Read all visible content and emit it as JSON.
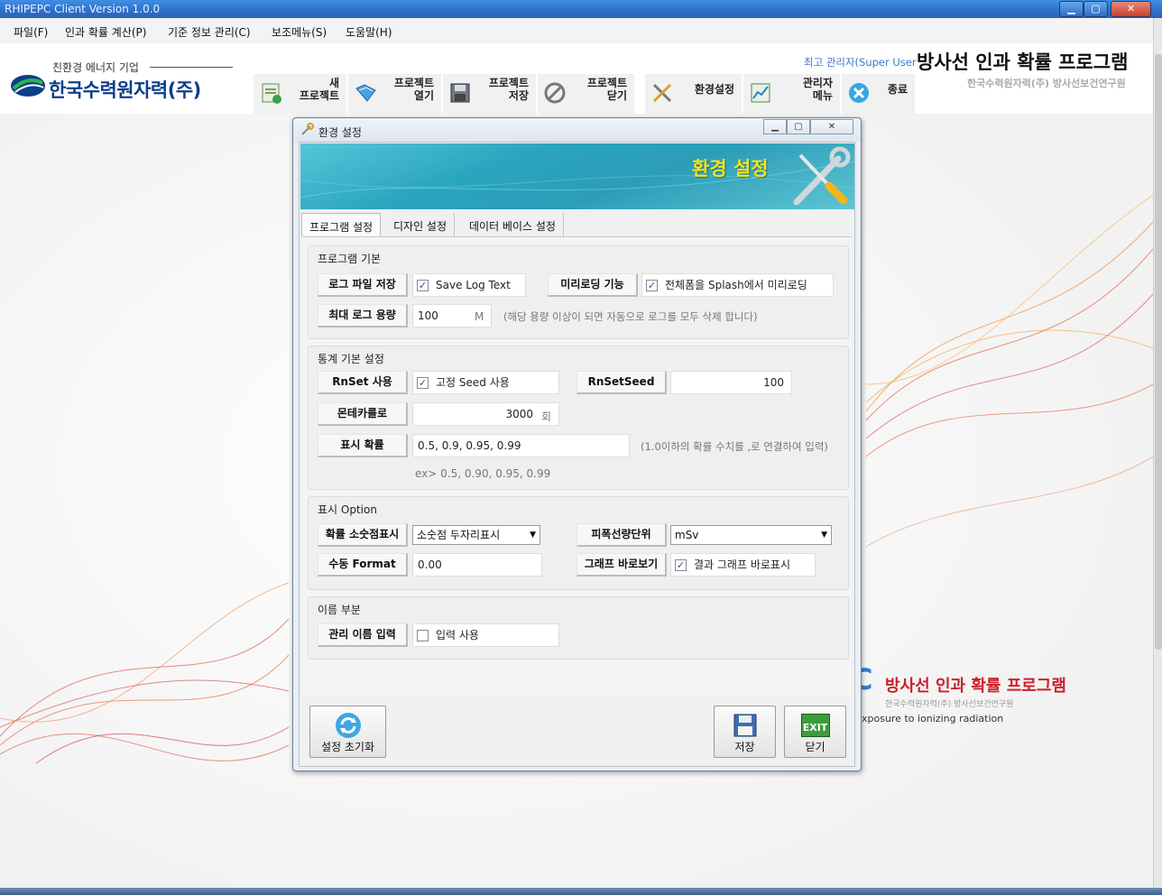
{
  "window": {
    "title": "RHIPEPC Client Version 1.0.0",
    "minimize": "▁",
    "maximize": "▢",
    "close": "✕"
  },
  "menu": [
    "파일(F)",
    "인과 확률 계산(P)",
    "기준 정보 관리(C)",
    "보조메뉴(S)",
    "도움말(H)"
  ],
  "brand": {
    "tagline": "친환경 에너지 기업",
    "name": "한국수력원자력(주)"
  },
  "toolbar": [
    {
      "label": "새\n프로젝트",
      "icon": "new-project-icon"
    },
    {
      "label": "프로젝트\n열기",
      "icon": "open-project-icon"
    },
    {
      "label": "프로젝트\n저장",
      "icon": "save-project-icon"
    },
    {
      "label": "프로젝트\n닫기",
      "icon": "close-project-icon"
    },
    {
      "label": "환경설정",
      "icon": "settings-tools-icon"
    },
    {
      "label": "관리자\n메뉴",
      "icon": "admin-chart-icon"
    },
    {
      "label": "종료",
      "icon": "exit-icon"
    }
  ],
  "header": {
    "user": "최고 관리자(Super User",
    "app_title": "방사선 인과 확률 프로그램",
    "app_sub": "한국수력원자력(주) 방사선보건연구원"
  },
  "background": {
    "title": "방사선 인과 확률 프로그램",
    "sub": "한국수력원자력(주) 방사선보건연구원",
    "tag": "xposure to ionizing radiation"
  },
  "dialog": {
    "title": "환경 설정",
    "banner_title": "환경 설정",
    "tabs": [
      "프로그램 설정",
      "디자인 설정",
      "데이터 베이스 설정"
    ],
    "groups": {
      "basic": {
        "title": "프로그램 기본",
        "log_save_label": "로그 파일 저장",
        "log_save_check": "Save Log Text",
        "log_save_checked": true,
        "preload_label": "미리로딩 기능",
        "preload_check": "전체폼을 Splash에서 미리로딩",
        "preload_checked": true,
        "max_log_label": "최대 로그 용량",
        "max_log_value": "100",
        "max_log_unit": "M",
        "max_log_hint": "(해당 용량 이상이 되면 자동으로 로그를 모두 삭제 합니다)"
      },
      "stats": {
        "title": "통계 기본 설정",
        "rnset_label": "RnSet 사용",
        "rnset_check": "고정 Seed 사용",
        "rnset_checked": true,
        "rnseed_label": "RnSetSeed",
        "rnseed_value": "100",
        "monte_label": "몬테카를로",
        "monte_value": "3000",
        "monte_unit": "회",
        "prob_label": "표시 확률",
        "prob_value": "0.5, 0.9, 0.95, 0.99",
        "prob_hint": "(1.0이하의 확률 수치를 ,로 연결하여 입력)",
        "prob_example": "ex> 0.5, 0.90, 0.95, 0.99"
      },
      "display": {
        "title": "표시 Option",
        "decimal_label": "확률 소숫점표시",
        "decimal_value": "소숫점 두자리표시",
        "dose_label": "피폭선량단위",
        "dose_value": "mSv",
        "format_label": "수동 Format",
        "format_value": "0.00",
        "graph_label": "그래프 바로보기",
        "graph_check": "결과 그래프 바로표시",
        "graph_checked": true
      },
      "name": {
        "title": "이름 부분",
        "manage_label": "관리 이름 입력",
        "manage_check": "입력 사용",
        "manage_checked": false
      }
    },
    "buttons": {
      "reset": "설정 초기화",
      "save": "저장",
      "close": "닫기",
      "exit_badge": "EXIT"
    }
  },
  "colors": {
    "banner": "#2aa5be",
    "banner_title": "#f8e41b",
    "brand": "#0c3e8a",
    "accent_red": "#cc1f2a"
  }
}
